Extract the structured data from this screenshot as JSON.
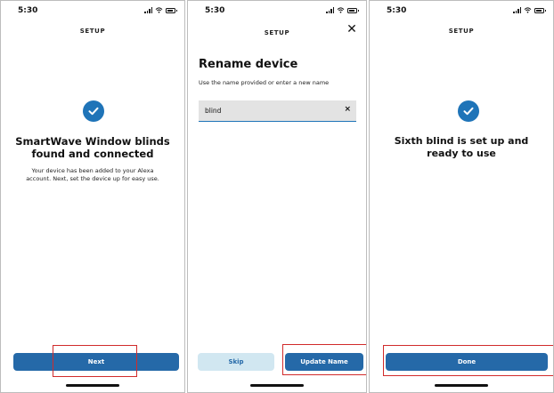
{
  "colors": {
    "accent": "#1f74b8",
    "primary_button": "#2569a8",
    "secondary_button": "#d1e7f1",
    "highlight": "#d12b2b"
  },
  "screen1": {
    "time": "5:30",
    "header": "SETUP",
    "icon": "check-circle-icon",
    "title_lines": [
      "SmartWave Window blinds",
      "found and connected"
    ],
    "desc_lines": [
      "Your device has been added to your Alexa",
      "account. Next, set the device up for easy use."
    ],
    "button": "Next"
  },
  "screen2": {
    "time": "5:30",
    "header": "SETUP",
    "close_icon": "close-icon",
    "heading": "Rename device",
    "subtext": "Use the name provided or enter a new name",
    "input_value": "blind",
    "skip": "Skip",
    "update": "Update Name"
  },
  "screen3": {
    "time": "5:30",
    "header": "SETUP",
    "icon": "check-circle-icon",
    "title_lines": [
      "Sixth blind is set up and",
      "ready to use"
    ],
    "button": "Done"
  }
}
